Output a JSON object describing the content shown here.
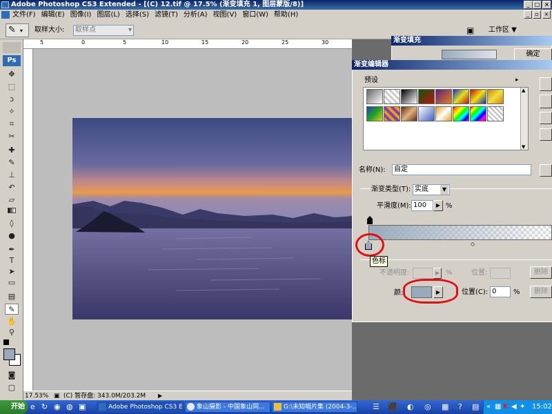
{
  "window": {
    "title": "Adobe Photoshop CS3 Extended - [(C) 12.tif @ 17.5% (渐变填充 1, 图层蒙版/8)]"
  },
  "menu": [
    "文件(F)",
    "编辑(E)",
    "图像(I)",
    "图层(L)",
    "选择(S)",
    "滤镜(T)",
    "分析(A)",
    "视图(V)",
    "窗口(W)",
    "帮助(H)"
  ],
  "options": {
    "sample_label": "取样大小:",
    "sample_value": "取样点",
    "workspace": "工作区 ▼"
  },
  "toolbox": {
    "logo": "Ps"
  },
  "document": {
    "zoom": "17.53%",
    "scratch": "(C) 暂存盘: 343.0M/203.2M"
  },
  "gradient_fill_dialog": {
    "title": "渐变填充",
    "ok_label": "确定"
  },
  "gradient_editor": {
    "title": "渐变编辑器",
    "presets_label": "预设",
    "name_label": "名称(N):",
    "name_value": "自定",
    "type_label": "渐变类型(T):",
    "type_value": "实底",
    "smooth_label": "平滑度(M):",
    "smooth_value": "100",
    "smooth_unit": "%",
    "stops_group": "色标",
    "opacity_label": "不透明度:",
    "opacity_unit": "%",
    "opacity_pos_label": "位置:",
    "delete_label": "删除",
    "color_label": "颜",
    "color_suffix": ":",
    "color_pos_label": "位置(C):",
    "color_pos_value": "0",
    "color_pos_unit": "%",
    "stop_color": "#9aaabb"
  },
  "taskbar": {
    "start": "开始",
    "tasks": [
      "Adobe Photoshop CS3 E...",
      "象山摄影 - 中国象山同...",
      "G:\\未知唱片集 (2004-3-..."
    ],
    "clock": "15:02"
  }
}
